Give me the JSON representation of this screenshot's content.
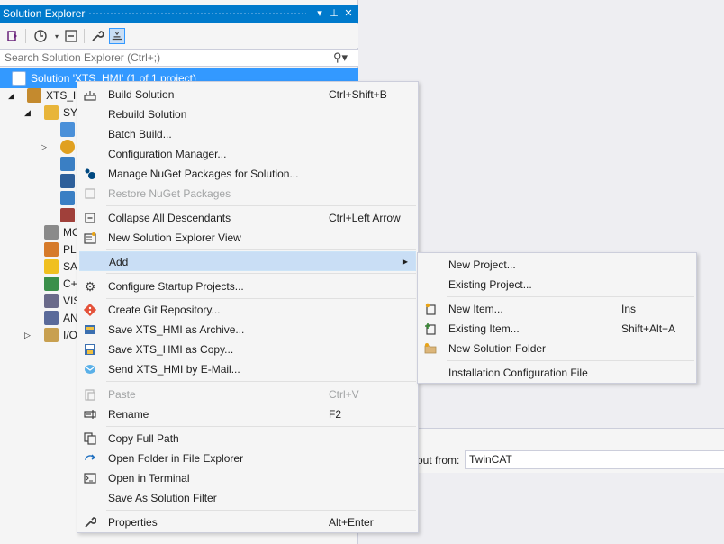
{
  "solution_explorer": {
    "title": "Solution Explorer",
    "title_buttons": [
      "▾",
      "⊥",
      "✕"
    ],
    "search_placeholder": "Search Solution Explorer (Ctrl+;)",
    "tree": [
      {
        "label": "Solution 'XTS_HMI' (1 of 1 project)",
        "selected": true
      },
      {
        "label": "XTS_H"
      },
      {
        "label": "SYS"
      },
      {
        "label": ""
      },
      {
        "label": ""
      },
      {
        "label": ""
      },
      {
        "label": ""
      },
      {
        "label": ""
      },
      {
        "label": "MO"
      },
      {
        "label": "PL"
      },
      {
        "label": "SA"
      },
      {
        "label": "C+"
      },
      {
        "label": "VIS"
      },
      {
        "label": "AN"
      },
      {
        "label": "I/O"
      }
    ]
  },
  "output_panel": {
    "show_from_label": "out from:",
    "source_value": "TwinCAT"
  },
  "context_menu": {
    "items": [
      {
        "label": "Build Solution",
        "shortcut": "Ctrl+Shift+B",
        "icon": "build-icon"
      },
      {
        "label": "Rebuild Solution",
        "shortcut": ""
      },
      {
        "label": "Batch Build...",
        "shortcut": ""
      },
      {
        "label": "Configuration Manager...",
        "shortcut": ""
      },
      {
        "label": "Manage NuGet Packages for Solution...",
        "shortcut": "",
        "icon": "nuget-icon"
      },
      {
        "label": "Restore NuGet Packages",
        "shortcut": "",
        "icon": "restore-icon",
        "disabled": true
      },
      {
        "label": "Collapse All Descendants",
        "shortcut": "Ctrl+Left Arrow",
        "icon": "collapse-icon"
      },
      {
        "label": "New Solution Explorer View",
        "shortcut": "",
        "icon": "new-view-icon"
      },
      {
        "label": "Add",
        "shortcut": "",
        "submenu": true
      },
      {
        "label": "Configure Startup Projects...",
        "shortcut": "",
        "icon": "gear-icon"
      },
      {
        "label": "Create Git Repository...",
        "shortcut": "",
        "icon": "git-icon"
      },
      {
        "label": "Save XTS_HMI as Archive...",
        "shortcut": "",
        "icon": "archive-icon"
      },
      {
        "label": "Save XTS_HMI as Copy...",
        "shortcut": "",
        "icon": "save-copy-icon"
      },
      {
        "label": "Send XTS_HMI by E-Mail...",
        "shortcut": "",
        "icon": "email-icon"
      },
      {
        "label": "Paste",
        "shortcut": "Ctrl+V",
        "icon": "paste-icon",
        "disabled": true
      },
      {
        "label": "Rename",
        "shortcut": "F2",
        "icon": "rename-icon"
      },
      {
        "label": "Copy Full Path",
        "shortcut": "",
        "icon": "copy-icon"
      },
      {
        "label": "Open Folder in File Explorer",
        "shortcut": "",
        "icon": "open-folder-icon"
      },
      {
        "label": "Open in Terminal",
        "shortcut": "",
        "icon": "terminal-icon"
      },
      {
        "label": "Save As Solution Filter",
        "shortcut": ""
      },
      {
        "label": "Properties",
        "shortcut": "Alt+Enter",
        "icon": "wrench-icon"
      }
    ]
  },
  "add_submenu": {
    "items": [
      {
        "label": "New Project...",
        "shortcut": ""
      },
      {
        "label": "Existing Project...",
        "shortcut": ""
      },
      {
        "label": "New Item...",
        "shortcut": "Ins",
        "icon": "new-item-icon"
      },
      {
        "label": "Existing Item...",
        "shortcut": "Shift+Alt+A",
        "icon": "existing-item-icon"
      },
      {
        "label": "New Solution Folder",
        "shortcut": "",
        "icon": "folder-icon"
      },
      {
        "label": "Installation Configuration File",
        "shortcut": ""
      }
    ]
  },
  "colors": {
    "accent": "#007acc",
    "selection": "#3399ff",
    "hover": "#c9def5",
    "disabled_text": "#a2a4a5"
  }
}
